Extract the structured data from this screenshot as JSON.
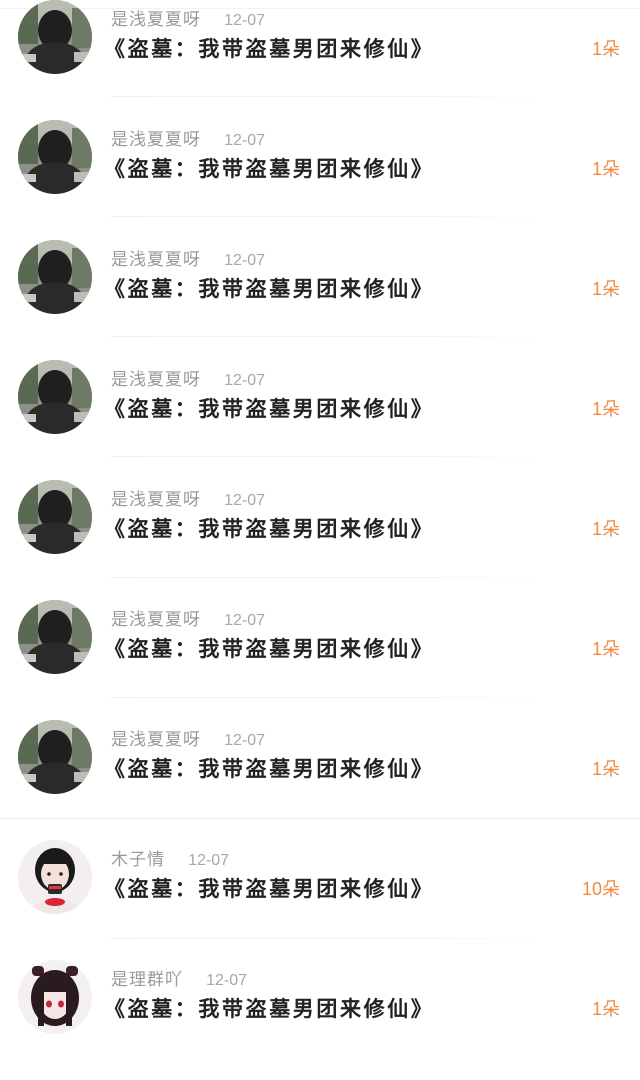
{
  "gifts": [
    {
      "user": "是浅夏夏呀",
      "date": "12-07",
      "title": "《盗墓：我带盗墓男团来修仙》",
      "count": "1朵",
      "avatar": "dark-photo-avatar"
    },
    {
      "user": "是浅夏夏呀",
      "date": "12-07",
      "title": "《盗墓：我带盗墓男团来修仙》",
      "count": "1朵",
      "avatar": "dark-photo-avatar"
    },
    {
      "user": "是浅夏夏呀",
      "date": "12-07",
      "title": "《盗墓：我带盗墓男团来修仙》",
      "count": "1朵",
      "avatar": "dark-photo-avatar"
    },
    {
      "user": "是浅夏夏呀",
      "date": "12-07",
      "title": "《盗墓：我带盗墓男团来修仙》",
      "count": "1朵",
      "avatar": "dark-photo-avatar"
    },
    {
      "user": "是浅夏夏呀",
      "date": "12-07",
      "title": "《盗墓：我带盗墓男团来修仙》",
      "count": "1朵",
      "avatar": "dark-photo-avatar"
    },
    {
      "user": "是浅夏夏呀",
      "date": "12-07",
      "title": "《盗墓：我带盗墓男团来修仙》",
      "count": "1朵",
      "avatar": "dark-photo-avatar"
    },
    {
      "user": "是浅夏夏呀",
      "date": "12-07",
      "title": "《盗墓：我带盗墓男团来修仙》",
      "count": "1朵",
      "avatar": "dark-photo-avatar"
    },
    {
      "user": "木子情",
      "date": "12-07",
      "title": "《盗墓：我带盗墓男团来修仙》",
      "count": "10朵",
      "avatar": "girl-illustration-avatar"
    },
    {
      "user": "是理群吖",
      "date": "12-07",
      "title": "《盗墓：我带盗墓男团来修仙》",
      "count": "1朵",
      "avatar": "anime-girl-avatar"
    }
  ],
  "colors": {
    "count_accent": "#f08a3e",
    "meta_text": "#9a9a9a",
    "title_text": "#222222"
  }
}
